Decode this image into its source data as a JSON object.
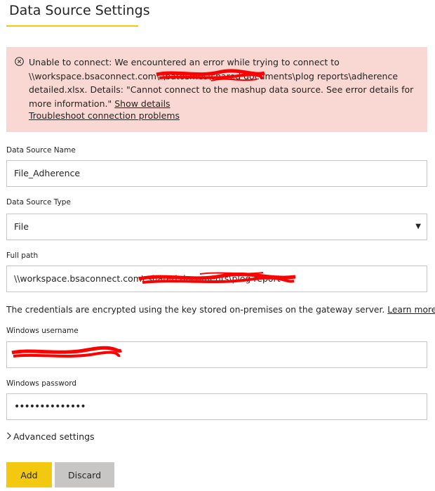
{
  "header": {
    "title": "Data Source Settings"
  },
  "error": {
    "message": "Unable to connect: We encountered an error while trying to connect to \\\\workspace.bsaconnect.com\\                    \\batosmes\\shared documents\\plog reports\\adherence detailed.xlsx. Details: \"Cannot connect to the mashup data source. See error details for more information.\"",
    "show_details": "Show details",
    "troubleshoot": "Troubleshoot connection problems"
  },
  "form": {
    "name_label": "Data Source Name",
    "name_value": "File_Adherence",
    "type_label": "Data Source Type",
    "type_value": "File",
    "path_label": "Full path",
    "path_value": "\\\\workspace.bsaconnect.com\\                                                  shared documents\\plog report",
    "cred_note": "The credentials are encrypted using the key stored on-premises on the gateway server.",
    "learn_more": "Learn more",
    "username_label": "Windows username",
    "username_value": "",
    "password_label": "Windows password",
    "password_value": "••••••••••••••",
    "advanced": "Advanced settings"
  },
  "buttons": {
    "add": "Add",
    "discard": "Discard"
  },
  "colors": {
    "accent": "#f2c811",
    "error_bg": "#f9d7d2",
    "discard_bg": "#c8c6c4",
    "redaction": "#ff0000"
  },
  "icons": {
    "error": "error-circle-icon",
    "select": "dropdown-arrow-icon",
    "advanced": "chevron-right-icon"
  }
}
